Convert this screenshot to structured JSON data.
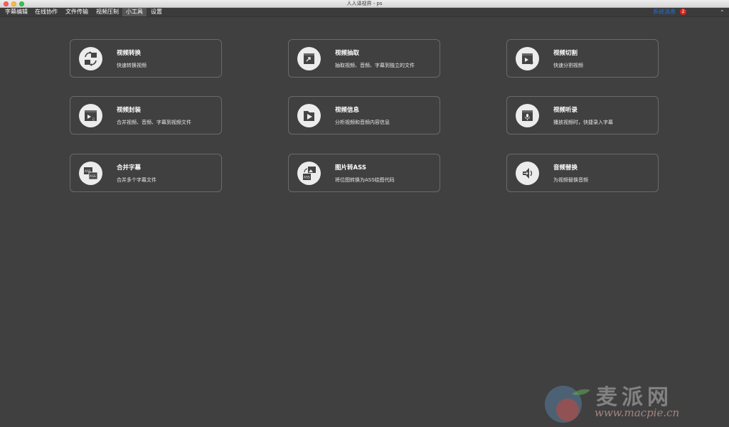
{
  "window": {
    "title": "人人译视界 - ps"
  },
  "menu": [
    {
      "label": "字幕编辑",
      "active": false
    },
    {
      "label": "在线协作",
      "active": false
    },
    {
      "label": "文件传输",
      "active": false
    },
    {
      "label": "视频压制",
      "active": false
    },
    {
      "label": "小工具",
      "active": true
    },
    {
      "label": "设置",
      "active": false
    }
  ],
  "system_message": {
    "label": "系统消息",
    "count": "2"
  },
  "collapse_icon": "chevron-up-icon",
  "tools": [
    {
      "title": "视频转换",
      "desc": "快速转换视频",
      "icon": "video-convert-icon"
    },
    {
      "title": "视频抽取",
      "desc": "抽取视频、音频、字幕到独立的文件",
      "icon": "video-extract-icon"
    },
    {
      "title": "视频切割",
      "desc": "快速分割视频",
      "icon": "video-cut-icon"
    },
    {
      "title": "视频封装",
      "desc": "合并视频、音频、字幕到视频文件",
      "icon": "video-mux-icon"
    },
    {
      "title": "视频信息",
      "desc": "分析视频和音频内容信息",
      "icon": "video-info-icon"
    },
    {
      "title": "视频听录",
      "desc": "播放视频时，快捷录入字幕",
      "icon": "video-transcribe-icon"
    },
    {
      "title": "合并字幕",
      "desc": "合并多个字幕文件",
      "icon": "subtitle-merge-icon"
    },
    {
      "title": "图片转ASS",
      "desc": "将位图转换为ASS绘图代码",
      "icon": "image-to-ass-icon"
    },
    {
      "title": "音频替换",
      "desc": "为视频替换音频",
      "icon": "audio-replace-icon"
    }
  ],
  "watermark": {
    "text": "麦派网",
    "url": "www.macpie.cn"
  },
  "colors": {
    "background": "#404040",
    "card_border": "#6a6a6a",
    "accent": "#1f6fe0",
    "badge": "#e8231c"
  }
}
